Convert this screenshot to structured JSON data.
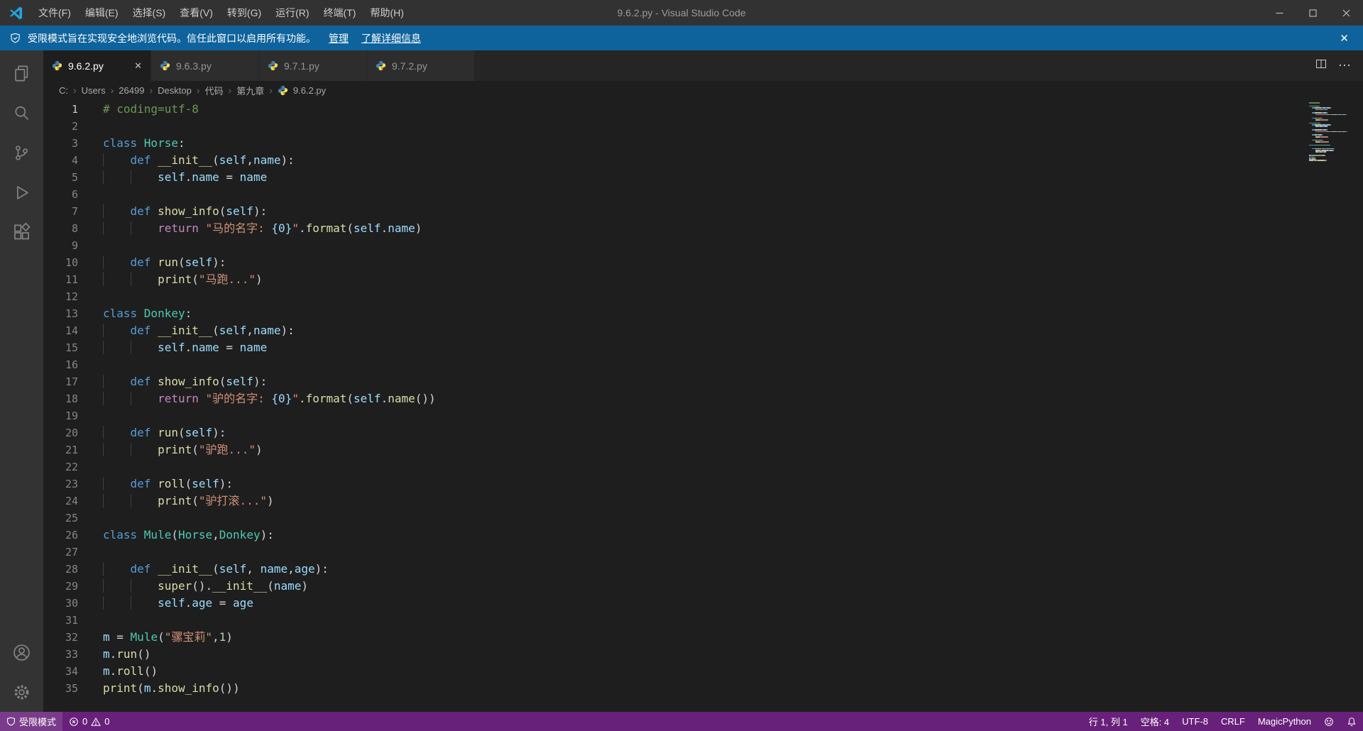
{
  "colors": {
    "accent": "#007ACC",
    "banner_background": "#0E639C",
    "statusbar_background": "#68217A",
    "editor_background": "#1e1e1e"
  },
  "icons": {
    "close": "✕",
    "more": "⋯",
    "breadcrumb_separator": "›"
  },
  "title_bar": {
    "menus": [
      "文件(F)",
      "编辑(E)",
      "选择(S)",
      "查看(V)",
      "转到(G)",
      "运行(R)",
      "终端(T)",
      "帮助(H)"
    ],
    "title": "9.6.2.py - Visual Studio Code"
  },
  "banner": {
    "message": "受限模式旨在实现安全地浏览代码。信任此窗口以启用所有功能。",
    "manage_link": "管理",
    "learn_more_link": "了解详细信息"
  },
  "activity_bar": {
    "items": [
      "explorer",
      "search",
      "source-control",
      "run-debug",
      "extensions"
    ],
    "bottom": [
      "account",
      "settings"
    ]
  },
  "tabs": {
    "items": [
      {
        "label": "9.6.2.py",
        "active": true
      },
      {
        "label": "9.6.3.py",
        "active": false
      },
      {
        "label": "9.7.1.py",
        "active": false
      },
      {
        "label": "9.7.2.py",
        "active": false
      }
    ]
  },
  "breadcrumb": {
    "items": [
      "C:",
      "Users",
      "26499",
      "Desktop",
      "代码",
      "第九章",
      "9.6.2.py"
    ]
  },
  "editor": {
    "language": "python",
    "lines": [
      {
        "n": 1,
        "i": 0,
        "t": [
          [
            "cm",
            "# coding=utf-8"
          ]
        ]
      },
      {
        "n": 2,
        "i": 0,
        "t": []
      },
      {
        "n": 3,
        "i": 0,
        "t": [
          [
            "kw",
            "class "
          ],
          [
            "cl",
            "Horse"
          ],
          [
            "pl",
            ":"
          ]
        ]
      },
      {
        "n": 4,
        "i": 1,
        "t": [
          [
            "kw",
            "def "
          ],
          [
            "fn",
            "__init__"
          ],
          [
            "pl",
            "("
          ],
          [
            "va",
            "self"
          ],
          [
            "pl",
            ","
          ],
          [
            "va",
            "name"
          ],
          [
            "pl",
            "):"
          ]
        ]
      },
      {
        "n": 5,
        "i": 2,
        "t": [
          [
            "va",
            "self"
          ],
          [
            "pl",
            "."
          ],
          [
            "va",
            "name"
          ],
          [
            "pl",
            " = "
          ],
          [
            "va",
            "name"
          ]
        ]
      },
      {
        "n": 6,
        "i": 0,
        "t": []
      },
      {
        "n": 7,
        "i": 1,
        "t": [
          [
            "kw",
            "def "
          ],
          [
            "fn",
            "show_info"
          ],
          [
            "pl",
            "("
          ],
          [
            "va",
            "self"
          ],
          [
            "pl",
            "):"
          ]
        ]
      },
      {
        "n": 8,
        "i": 2,
        "t": [
          [
            "ct",
            "return "
          ],
          [
            "st",
            "\"马的名字: "
          ],
          [
            "fs",
            "{0}"
          ],
          [
            "st",
            "\""
          ],
          [
            "pl",
            "."
          ],
          [
            "fn",
            "format"
          ],
          [
            "pl",
            "("
          ],
          [
            "va",
            "self"
          ],
          [
            "pl",
            "."
          ],
          [
            "va",
            "name"
          ],
          [
            "pl",
            ")"
          ]
        ]
      },
      {
        "n": 9,
        "i": 0,
        "t": []
      },
      {
        "n": 10,
        "i": 1,
        "t": [
          [
            "kw",
            "def "
          ],
          [
            "fn",
            "run"
          ],
          [
            "pl",
            "("
          ],
          [
            "va",
            "self"
          ],
          [
            "pl",
            "):"
          ]
        ]
      },
      {
        "n": 11,
        "i": 2,
        "t": [
          [
            "fn",
            "print"
          ],
          [
            "pl",
            "("
          ],
          [
            "st",
            "\"马跑...\""
          ],
          [
            "pl",
            ")"
          ]
        ]
      },
      {
        "n": 12,
        "i": 0,
        "t": []
      },
      {
        "n": 13,
        "i": 0,
        "t": [
          [
            "kw",
            "class "
          ],
          [
            "cl",
            "Donkey"
          ],
          [
            "pl",
            ":"
          ]
        ]
      },
      {
        "n": 14,
        "i": 1,
        "t": [
          [
            "kw",
            "def "
          ],
          [
            "fn",
            "__init__"
          ],
          [
            "pl",
            "("
          ],
          [
            "va",
            "self"
          ],
          [
            "pl",
            ","
          ],
          [
            "va",
            "name"
          ],
          [
            "pl",
            "):"
          ]
        ]
      },
      {
        "n": 15,
        "i": 2,
        "t": [
          [
            "va",
            "self"
          ],
          [
            "pl",
            "."
          ],
          [
            "va",
            "name"
          ],
          [
            "pl",
            " = "
          ],
          [
            "va",
            "name"
          ]
        ]
      },
      {
        "n": 16,
        "i": 0,
        "t": []
      },
      {
        "n": 17,
        "i": 1,
        "t": [
          [
            "kw",
            "def "
          ],
          [
            "fn",
            "show_info"
          ],
          [
            "pl",
            "("
          ],
          [
            "va",
            "self"
          ],
          [
            "pl",
            "):"
          ]
        ]
      },
      {
        "n": 18,
        "i": 2,
        "t": [
          [
            "ct",
            "return "
          ],
          [
            "st",
            "\"驴的名字: "
          ],
          [
            "fs",
            "{0}"
          ],
          [
            "st",
            "\""
          ],
          [
            "pl",
            "."
          ],
          [
            "fn",
            "format"
          ],
          [
            "pl",
            "("
          ],
          [
            "va",
            "self"
          ],
          [
            "pl",
            "."
          ],
          [
            "fn",
            "name"
          ],
          [
            "pl",
            "())"
          ]
        ]
      },
      {
        "n": 19,
        "i": 0,
        "t": []
      },
      {
        "n": 20,
        "i": 1,
        "t": [
          [
            "kw",
            "def "
          ],
          [
            "fn",
            "run"
          ],
          [
            "pl",
            "("
          ],
          [
            "va",
            "self"
          ],
          [
            "pl",
            "):"
          ]
        ]
      },
      {
        "n": 21,
        "i": 2,
        "t": [
          [
            "fn",
            "print"
          ],
          [
            "pl",
            "("
          ],
          [
            "st",
            "\"驴跑...\""
          ],
          [
            "pl",
            ")"
          ]
        ]
      },
      {
        "n": 22,
        "i": 0,
        "t": []
      },
      {
        "n": 23,
        "i": 1,
        "t": [
          [
            "kw",
            "def "
          ],
          [
            "fn",
            "roll"
          ],
          [
            "pl",
            "("
          ],
          [
            "va",
            "self"
          ],
          [
            "pl",
            "):"
          ]
        ]
      },
      {
        "n": 24,
        "i": 2,
        "t": [
          [
            "fn",
            "print"
          ],
          [
            "pl",
            "("
          ],
          [
            "st",
            "\"驴打滚...\""
          ],
          [
            "pl",
            ")"
          ]
        ]
      },
      {
        "n": 25,
        "i": 0,
        "t": []
      },
      {
        "n": 26,
        "i": 0,
        "t": [
          [
            "kw",
            "class "
          ],
          [
            "cl",
            "Mule"
          ],
          [
            "pl",
            "("
          ],
          [
            "cl",
            "Horse"
          ],
          [
            "pl",
            ","
          ],
          [
            "cl",
            "Donkey"
          ],
          [
            "pl",
            "):"
          ]
        ]
      },
      {
        "n": 27,
        "i": 0,
        "t": []
      },
      {
        "n": 28,
        "i": 1,
        "t": [
          [
            "kw",
            "def "
          ],
          [
            "fn",
            "__init__"
          ],
          [
            "pl",
            "("
          ],
          [
            "va",
            "self"
          ],
          [
            "pl",
            ", "
          ],
          [
            "va",
            "name"
          ],
          [
            "pl",
            ","
          ],
          [
            "va",
            "age"
          ],
          [
            "pl",
            "):"
          ]
        ]
      },
      {
        "n": 29,
        "i": 2,
        "t": [
          [
            "fn",
            "super"
          ],
          [
            "pl",
            "()."
          ],
          [
            "fn",
            "__init__"
          ],
          [
            "pl",
            "("
          ],
          [
            "va",
            "name"
          ],
          [
            "pl",
            ")"
          ]
        ]
      },
      {
        "n": 30,
        "i": 2,
        "t": [
          [
            "va",
            "self"
          ],
          [
            "pl",
            "."
          ],
          [
            "va",
            "age"
          ],
          [
            "pl",
            " = "
          ],
          [
            "va",
            "age"
          ]
        ]
      },
      {
        "n": 31,
        "i": 0,
        "t": []
      },
      {
        "n": 32,
        "i": 0,
        "t": [
          [
            "va",
            "m"
          ],
          [
            "pl",
            " = "
          ],
          [
            "cl",
            "Mule"
          ],
          [
            "pl",
            "("
          ],
          [
            "st",
            "\"骡宝莉\""
          ],
          [
            "pl",
            ","
          ],
          [
            "nu",
            "1"
          ],
          [
            "pl",
            ")"
          ]
        ]
      },
      {
        "n": 33,
        "i": 0,
        "t": [
          [
            "va",
            "m"
          ],
          [
            "pl",
            "."
          ],
          [
            "fn",
            "run"
          ],
          [
            "pl",
            "()"
          ]
        ]
      },
      {
        "n": 34,
        "i": 0,
        "t": [
          [
            "va",
            "m"
          ],
          [
            "pl",
            "."
          ],
          [
            "fn",
            "roll"
          ],
          [
            "pl",
            "()"
          ]
        ]
      },
      {
        "n": 35,
        "i": 0,
        "t": [
          [
            "fn",
            "print"
          ],
          [
            "pl",
            "("
          ],
          [
            "va",
            "m"
          ],
          [
            "pl",
            "."
          ],
          [
            "fn",
            "show_info"
          ],
          [
            "pl",
            "())"
          ]
        ]
      }
    ]
  },
  "status_bar": {
    "restricted_label": "受限模式",
    "errors": "0",
    "warnings": "0",
    "cursor_position": "行 1, 列 1",
    "indentation": "空格: 4",
    "encoding": "UTF-8",
    "eol": "CRLF",
    "language_mode": "MagicPython"
  }
}
